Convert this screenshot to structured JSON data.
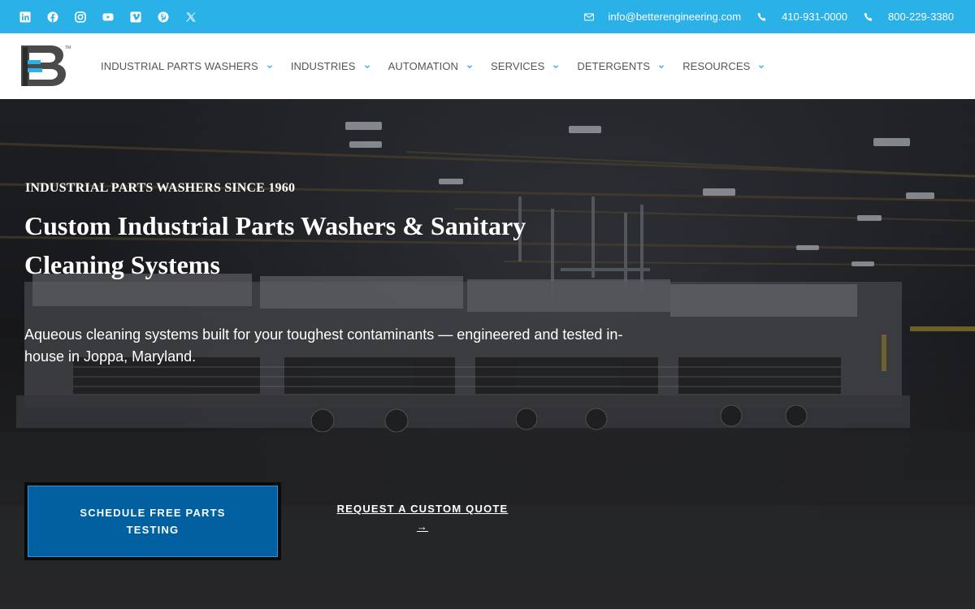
{
  "topbar": {
    "social": [
      "linkedin-icon",
      "facebook-icon",
      "instagram-icon",
      "youtube-icon",
      "vimeo-icon",
      "pinterest-icon",
      "x-icon"
    ],
    "email": "info@betterengineering.com",
    "phone_1": "410-931-0000",
    "phone_2": "800-229-3380",
    "background": "#29b1e8"
  },
  "nav": {
    "items": [
      {
        "label": "INDUSTRIAL PARTS WASHERS"
      },
      {
        "label": "INDUSTRIES"
      },
      {
        "label": "AUTOMATION"
      },
      {
        "label": "SERVICES"
      },
      {
        "label": "DETERGENTS"
      },
      {
        "label": "RESOURCES"
      }
    ],
    "chevron_color": "#29b1e8"
  },
  "hero": {
    "eyebrow": "INDUSTRIAL PARTS WASHERS SINCE 1960",
    "headline": "Custom Industrial Parts Washers & Sanitary Cleaning Systems",
    "subtext": "Aqueous cleaning systems built for your toughest contaminants — engineered and tested in-house in Joppa, Maryland.",
    "primary_cta": "SCHEDULE FREE PARTS TESTING",
    "secondary_cta": "REQUEST A CUSTOM QUOTE",
    "secondary_arrow": "→",
    "primary_color": "#0060a0"
  }
}
